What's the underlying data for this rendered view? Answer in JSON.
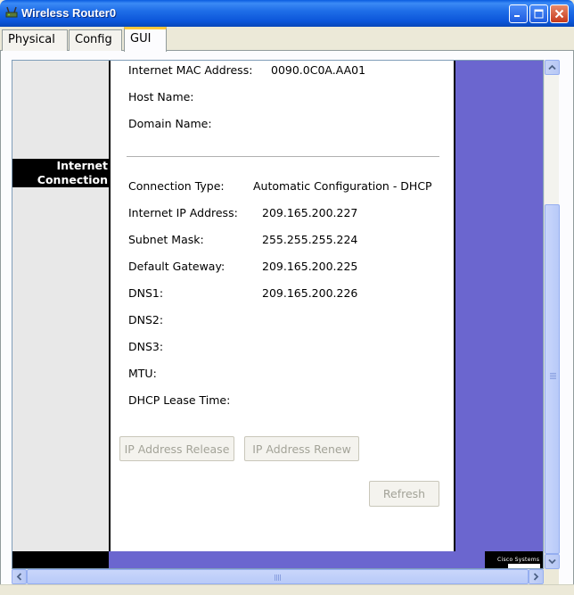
{
  "window": {
    "title": "Wireless Router0",
    "icon": "router-icon",
    "buttons": [
      "minimize-icon",
      "maximize-icon",
      "close-icon"
    ]
  },
  "tabs": [
    {
      "label": "Physical",
      "active": false
    },
    {
      "label": "Config",
      "active": false
    },
    {
      "label": "GUI",
      "active": true
    }
  ],
  "sidebar": {
    "section_line1": "Internet",
    "section_line2": "Connection"
  },
  "internet": {
    "mac_label": "Internet MAC Address:",
    "mac_value": "0090.0C0A.AA01",
    "host_label": "Host Name:",
    "host_value": "",
    "domain_label": "Domain Name:",
    "domain_value": "",
    "conn_type_label": "Connection Type:",
    "conn_type_value": "Automatic Configuration - DHCP",
    "ip_label": "Internet IP Address:",
    "ip_value": "209.165.200.227",
    "mask_label": "Subnet Mask:",
    "mask_value": "255.255.255.224",
    "gateway_label": "Default Gateway:",
    "gateway_value": "209.165.200.225",
    "dns1_label": "DNS1:",
    "dns1_value": "209.165.200.226",
    "dns2_label": "DNS2:",
    "dns2_value": "",
    "dns3_label": "DNS3:",
    "dns3_value": "",
    "mtu_label": "MTU:",
    "mtu_value": "",
    "lease_label": "DHCP Lease Time:",
    "lease_value": ""
  },
  "buttons": {
    "release": "IP Address Release",
    "renew": "IP Address Renew",
    "refresh": "Refresh"
  },
  "logo": {
    "text": "Cisco Systems"
  },
  "colors": {
    "accent": "#6b66cf",
    "titlebar": "#0b55d9",
    "disabled_text": "#a3a398"
  }
}
